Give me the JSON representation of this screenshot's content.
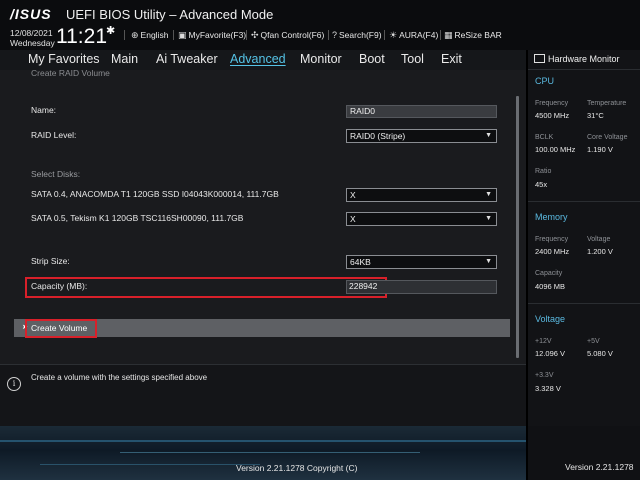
{
  "topbar": {
    "logo": "/ISUS",
    "title": "UEFI BIOS Utility – Advanced Mode",
    "date": "12/08/2021",
    "day": "Wednesday",
    "time": "11:21",
    "tools": [
      {
        "icon": "globe-icon",
        "label": "English"
      },
      {
        "icon": "favorite-icon",
        "label": "MyFavorite(F3)"
      },
      {
        "icon": "fan-icon",
        "label": "Qfan Control(F6)"
      },
      {
        "icon": "search-icon",
        "label": "Search(F9)"
      },
      {
        "icon": "aura-icon",
        "label": "AURA(F4)"
      },
      {
        "icon": "resize-bar-icon",
        "label": "ReSize BAR"
      }
    ]
  },
  "nav": {
    "items": [
      "My Favorites",
      "Main",
      "Ai Tweaker",
      "Advanced",
      "Monitor",
      "Boot",
      "Tool",
      "Exit"
    ],
    "active": "Advanced"
  },
  "main": {
    "breadcrumb": "Create RAID Volume",
    "name_label": "Name:",
    "name_value": "RAID0",
    "raid_level_label": "RAID Level:",
    "raid_level_value": "RAID0 (Stripe)",
    "select_disks_label": "Select Disks:",
    "disks": [
      {
        "label": "SATA 0.4, ANACOMDA T1 120GB SSD I04043K000014, 111.7GB",
        "value": "X"
      },
      {
        "label": "SATA 0.5, Tekism K1 120GB TSC116SH00090, 111.7GB",
        "value": "X"
      }
    ],
    "strip_size_label": "Strip Size:",
    "strip_size_value": "64KB",
    "capacity_label": "Capacity (MB):",
    "capacity_value": "228942",
    "create_volume_label": "Create Volume"
  },
  "help": {
    "text": "Create a volume with the settings specified above"
  },
  "footer": {
    "version_center": "Version 2.21.1278 Copyright (C)",
    "version_right": "Version 2.21.1278"
  },
  "hardware_monitor": {
    "title": "Hardware Monitor",
    "cpu": {
      "section": "CPU",
      "frequency_label": "Frequency",
      "frequency": "4500 MHz",
      "temperature_label": "Temperature",
      "temperature": "31°C",
      "bclk_label": "BCLK",
      "bclk": "100.00 MHz",
      "core_voltage_label": "Core Voltage",
      "core_voltage": "1.190 V",
      "ratio_label": "Ratio",
      "ratio": "45x"
    },
    "memory": {
      "section": "Memory",
      "frequency_label": "Frequency",
      "frequency": "2400 MHz",
      "voltage_label": "Voltage",
      "voltage": "1.200 V",
      "capacity_label": "Capacity",
      "capacity": "4096 MB"
    },
    "voltage": {
      "section": "Voltage",
      "v12_label": "+12V",
      "v12": "12.096 V",
      "v5_label": "+5V",
      "v5": "5.080 V",
      "v33_label": "+3.3V",
      "v33": "3.328 V"
    }
  },
  "colors": {
    "accent": "#55c3e6",
    "highlight_box": "#d8202a",
    "background": "#15171a"
  }
}
